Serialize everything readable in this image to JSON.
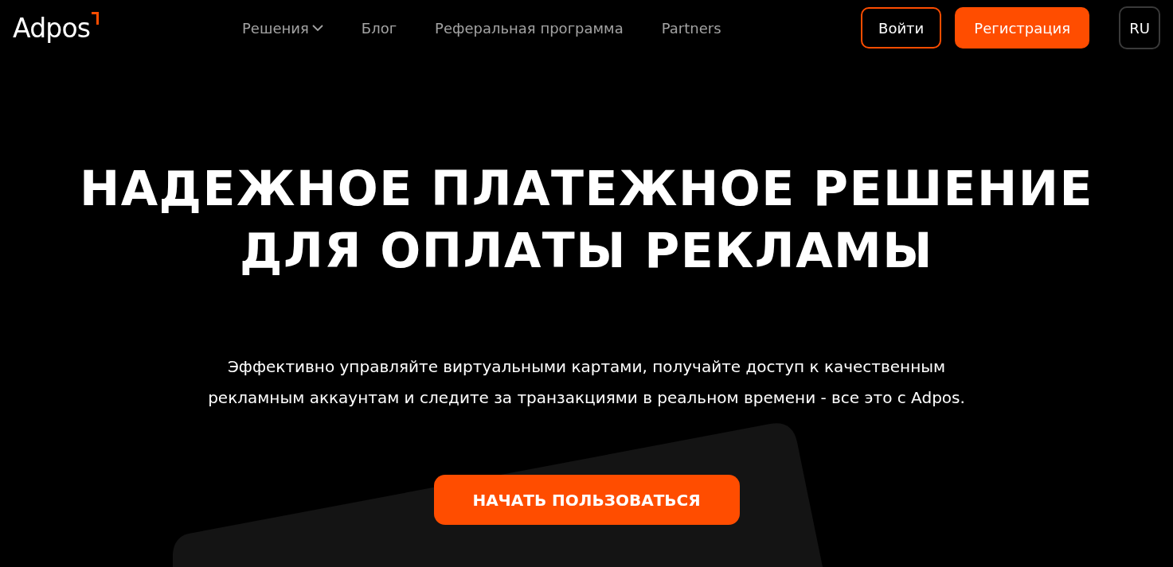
{
  "header": {
    "logo": "Adpos",
    "nav": [
      {
        "label": "Решения",
        "kind": "dropdown"
      },
      {
        "label": "Блог",
        "kind": "link"
      },
      {
        "label": "Реферальная программа",
        "kind": "link"
      },
      {
        "label": "Partners",
        "kind": "link"
      }
    ],
    "login": "Войти",
    "register": "Регистрация",
    "language": "RU"
  },
  "hero": {
    "title_lines": [
      "НАДЕЖНОЕ ПЛАТЕЖНОЕ РЕШЕНИЕ",
      "ДЛЯ ОПЛАТЫ РЕКЛАМЫ"
    ],
    "subtitle": "Эффективно управляйте виртуальными картами, получайте доступ к качественным рекламным аккаунтам и следите за транзакциями в реальном времени - все это с Adpos.",
    "cta": "НАЧАТЬ ПОЛЬЗОВАТЬСЯ"
  }
}
